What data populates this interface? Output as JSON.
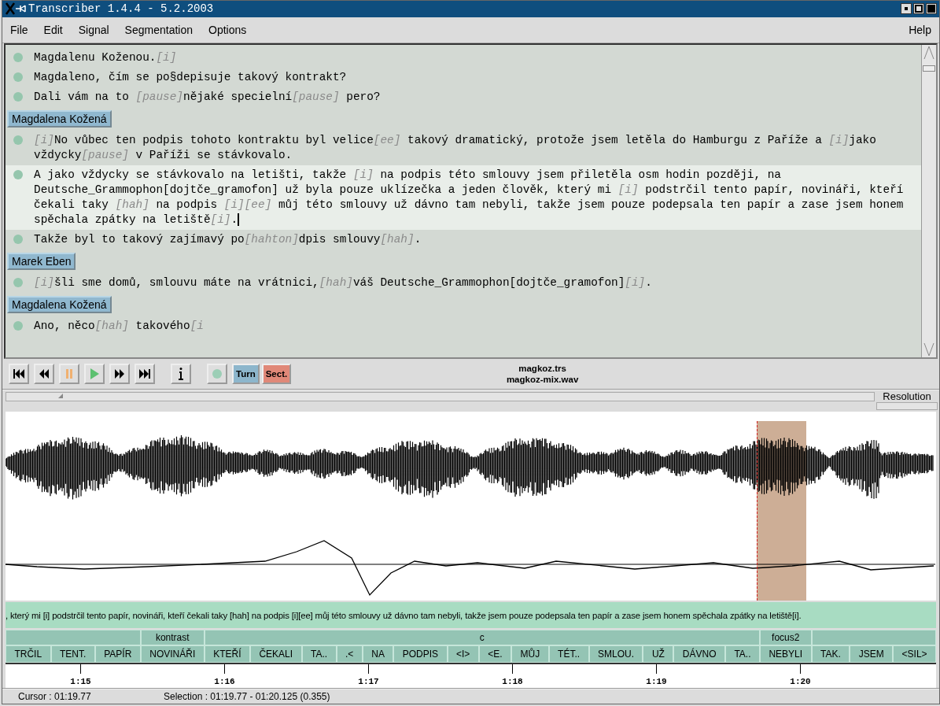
{
  "window": {
    "title": "Transcriber 1.4.4 - 5.2.2003"
  },
  "menu": {
    "items": [
      "File",
      "Edit",
      "Signal",
      "Segmentation",
      "Options"
    ],
    "help": "Help"
  },
  "editor": {
    "lines": [
      {
        "kind": "segment",
        "parts": [
          {
            "text": "Magdalenu Koženou."
          },
          {
            "text": "[i]",
            "tag": true
          }
        ],
        "selected": false
      },
      {
        "kind": "segment",
        "parts": [
          {
            "text": "Magdaleno, čím se po§depisuje takový kontrakt?"
          }
        ],
        "selected": false
      },
      {
        "kind": "segment",
        "parts": [
          {
            "text": "Dali vám na to "
          },
          {
            "text": "[pause]",
            "tag": true
          },
          {
            "text": "nějaké specielní"
          },
          {
            "text": "[pause]",
            "tag": true
          },
          {
            "text": " pero?"
          }
        ],
        "selected": false
      },
      {
        "kind": "turn",
        "speaker": "Magdalena Kožená"
      },
      {
        "kind": "segment",
        "parts": [
          {
            "text": "[i]",
            "tag": true
          },
          {
            "text": "No vůbec ten podpis tohoto kontraktu byl velice"
          },
          {
            "text": "[ee]",
            "tag": true
          },
          {
            "text": " takový dramatický, protože jsem letěla do Hamburgu z Paříže a "
          },
          {
            "text": "[i]",
            "tag": true
          },
          {
            "text": "jako vždycky"
          },
          {
            "text": "[pause]",
            "tag": true
          },
          {
            "text": " v Paříži se stávkovalo."
          }
        ],
        "selected": false
      },
      {
        "kind": "segment",
        "parts": [
          {
            "text": "A jako vždycky se stávkovalo na letišti, takže "
          },
          {
            "text": "[i]",
            "tag": true
          },
          {
            "text": " na podpis této smlouvy jsem přiletěla osm hodin později, na Deutsche_Grammophon[dojtče_gramofon] už byla pouze uklízečka a jeden člověk, který mi "
          },
          {
            "text": "[i]",
            "tag": true
          },
          {
            "text": " podstrčil tento papír, novináři, kteří čekali taky "
          },
          {
            "text": "[hah]",
            "tag": true
          },
          {
            "text": " na podpis "
          },
          {
            "text": "[i][ee]",
            "tag": true
          },
          {
            "text": " můj této smlouvy už dávno tam nebyli, takže jsem pouze podepsala ten papír a zase jsem honem spěchala zpátky na letiště"
          },
          {
            "text": "[i]",
            "tag": true
          },
          {
            "text": "."
          }
        ],
        "selected": true,
        "caret": true
      },
      {
        "kind": "segment",
        "parts": [
          {
            "text": "Takže byl to takový zajímavý po"
          },
          {
            "text": "[hahton]",
            "tag": true
          },
          {
            "text": "dpis smlouvy"
          },
          {
            "text": "[hah]",
            "tag": true
          },
          {
            "text": "."
          }
        ],
        "selected": false
      },
      {
        "kind": "turn",
        "speaker": "Marek Eben"
      },
      {
        "kind": "segment",
        "parts": [
          {
            "text": "[i]",
            "tag": true
          },
          {
            "text": "šli sme domů, smlouvu máte na vrátnici,"
          },
          {
            "text": "[hah]",
            "tag": true
          },
          {
            "text": "váš Deutsche_Grammophon[dojtče_gramofon]"
          },
          {
            "text": "[i]",
            "tag": true
          },
          {
            "text": "."
          }
        ],
        "selected": false
      },
      {
        "kind": "turn",
        "speaker": "Magdalena Kožená"
      },
      {
        "kind": "segment",
        "parts": [
          {
            "text": "Ano, něco"
          },
          {
            "text": "[hah]",
            "tag": true
          },
          {
            "text": " takového"
          },
          {
            "text": "[i",
            "tag": true
          }
        ],
        "selected": false
      }
    ]
  },
  "toolbar": {
    "buttons": [
      {
        "kind": "first"
      },
      {
        "kind": "rewind"
      },
      {
        "kind": "pause"
      },
      {
        "kind": "play"
      },
      {
        "kind": "forward"
      },
      {
        "kind": "last"
      },
      {
        "kind": "info"
      },
      {
        "kind": "segment"
      },
      {
        "kind": "turn",
        "label": "Turn"
      },
      {
        "kind": "section",
        "label": "Sect."
      }
    ],
    "files": [
      "magkoz.trs",
      "magkoz-mix.wav"
    ]
  },
  "resolution": {
    "label": "Resolution"
  },
  "transcript_band": ", který mi [i] podstrčil tento papír, novináři, kteří čekali taky [hah] na podpis [i][ee] můj této smlouvy už dávno tam nebyli, takže jsem pouze podepsala ten papír a zase jsem honem spěchala zpátky na letiště[i].",
  "sections": [
    {
      "words": [
        "TRČIL",
        "TENT.",
        "PAPÍR"
      ]
    },
    {
      "label": "kontrast",
      "words": [
        "NOVINÁŘI"
      ]
    },
    {
      "label": "c",
      "words": [
        "KTEŘÍ",
        "ČEKALI",
        "TA..",
        ".<",
        "NA",
        "PODPIS",
        "<I>",
        "<E.",
        "MŮJ",
        "TÉT..",
        "SMLOU.",
        "UŽ",
        "DÁVNO",
        "TA.."
      ]
    },
    {
      "label": "focus2",
      "words": [
        "NEBYLI"
      ]
    },
    {
      "words": [
        "TAK.",
        "JSEM",
        "<SIL>"
      ]
    }
  ],
  "time_axis": [
    "1:15",
    "1:16",
    "1:17",
    "1:18",
    "1:19",
    "1:20"
  ],
  "status": {
    "cursor": "Cursor : 01:19.77",
    "selection": "Selection : 01:19.77 - 01:20.125 (0.355)"
  }
}
